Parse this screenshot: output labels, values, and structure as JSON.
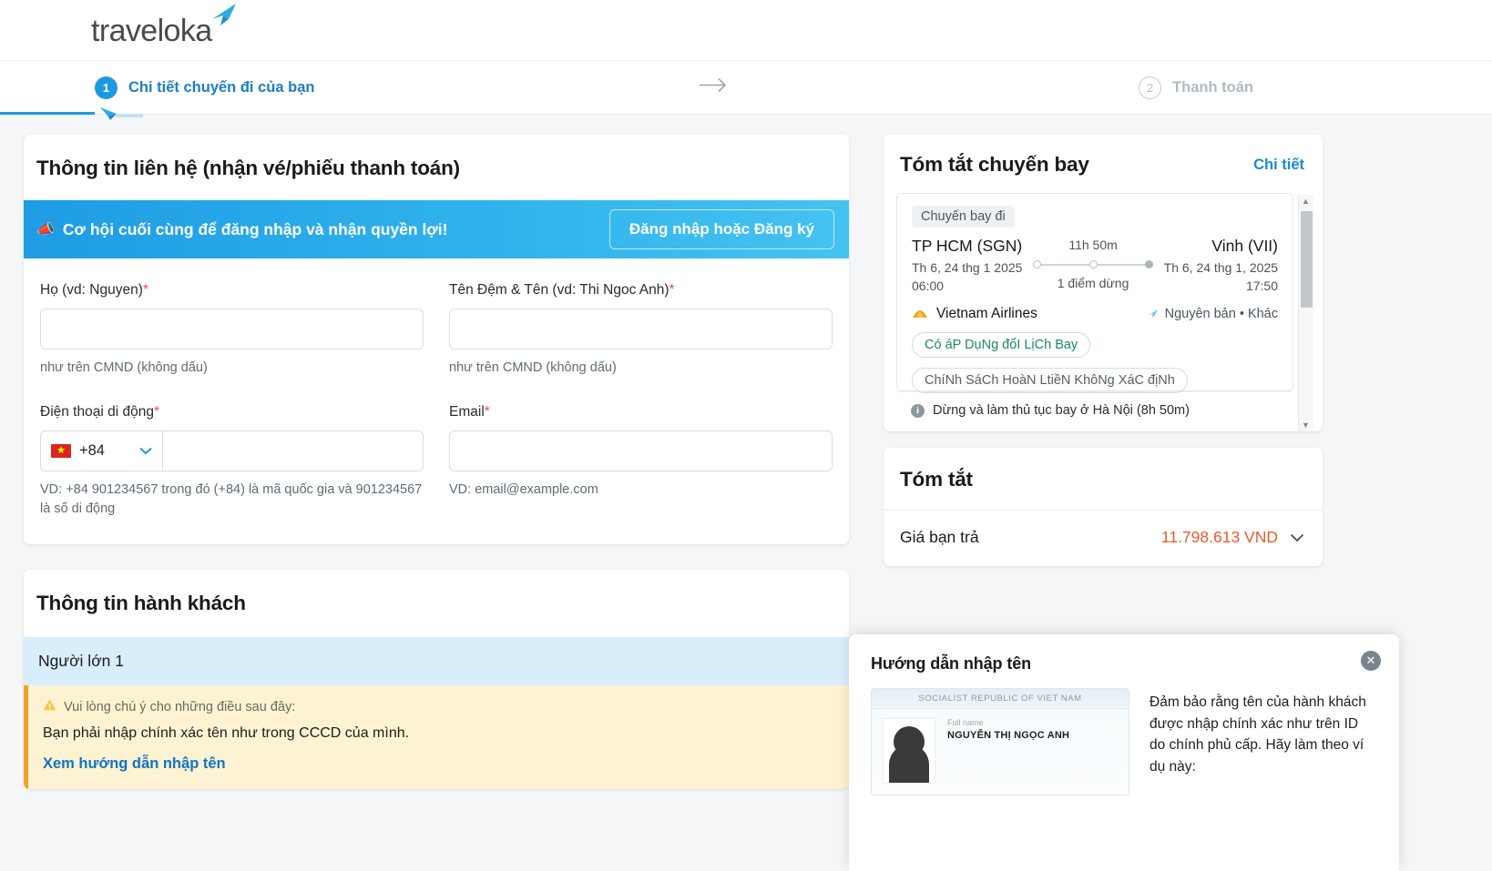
{
  "brand": {
    "name": "traveloka",
    "accent": "#1b9ae3"
  },
  "stepper": {
    "step1": {
      "num": "1",
      "label": "Chi tiết chuyến đi của bạn"
    },
    "step2": {
      "num": "2",
      "label": "Thanh toán"
    }
  },
  "contact": {
    "title": "Thông tin liên hệ (nhận vé/phiếu thanh toán)",
    "banner": {
      "text": "Cơ hội cuối cùng để đăng nhập và nhận quyền lợi!",
      "button": "Đăng nhập hoặc Đăng ký"
    },
    "last_name": {
      "label": "Họ (vd: Nguyen)",
      "value": "",
      "hint": "như trên CMND (không dấu)"
    },
    "first_name": {
      "label": "Tên Đệm & Tên (vd: Thi Ngoc Anh)",
      "value": "",
      "hint": "như trên CMND (không dấu)"
    },
    "phone": {
      "label": "Điện thoại di động",
      "country_code": "+84",
      "flag": "vietnam-flag",
      "value": "",
      "hint": "VD: +84 901234567 trong đó (+84) là mã quốc gia và 901234567 là số di động"
    },
    "email": {
      "label": "Email",
      "value": "",
      "hint": "VD: email@example.com"
    },
    "required_mark": "*"
  },
  "passenger": {
    "title": "Thông tin hành khách",
    "subheader": "Người lớn 1",
    "warning_head": "Vui lòng chú ý cho những điều sau đây:",
    "warning_body": "Bạn phải nhập chính xác tên như trong CCCD của mình.",
    "warning_link": "Xem hướng dẫn nhập tên"
  },
  "flight_summary": {
    "title": "Tóm tắt chuyến bay",
    "detail_link": "Chi tiết",
    "chip": "Chuyến bay đi",
    "origin": {
      "city": "TP HCM (SGN)",
      "date": "Th 6, 24 thg 1 2025",
      "time": "06:00"
    },
    "destination": {
      "city": "Vinh (VII)",
      "date": "Th 6, 24 thg 1, 2025",
      "time": "17:50"
    },
    "duration": "11h 50m",
    "stops": "1 điểm dừng",
    "airline": "Vietnam Airlines",
    "fare_class": "Nguyên bản • Khác",
    "tags": [
      "Có áP DụNg đổI LịCh Bay",
      "ChíNh SáCh HoàN LtiềN KhôNg XáC địNh"
    ],
    "transit_note": "Dừng và làm thủ tục bay ở Hà Nội (8h 50m)"
  },
  "total": {
    "title": "Tóm tắt",
    "label": "Giá bạn trả",
    "value": "11.798.613 VND",
    "color": "#f0592a"
  },
  "name_guide": {
    "title": "Hướng dẫn nhập tên",
    "id_header": "SOCIALIST REPUBLIC OF VIET NAM",
    "id_fullname_label": "Full name",
    "id_fullname": "NGUYỄN THỊ NGỌC ANH",
    "description": "Đảm bảo rằng tên của hành khách được nhập chính xác như trên ID do chính phủ cấp. Hãy làm theo ví dụ này:",
    "close": "✕"
  }
}
